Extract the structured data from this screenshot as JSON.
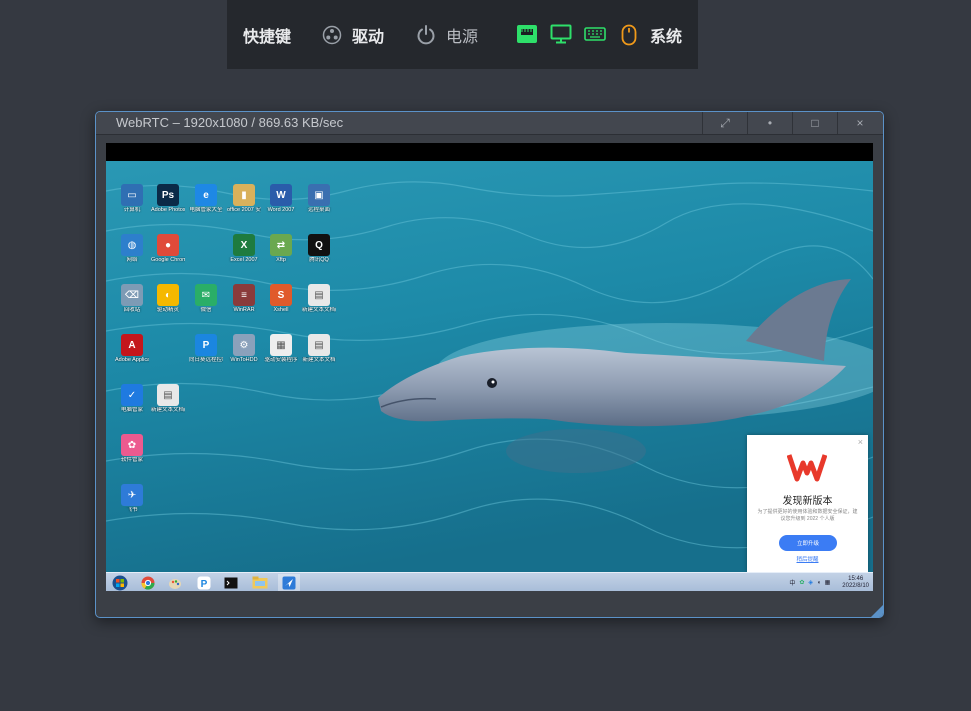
{
  "toolbar": {
    "shortcuts_label": "快捷键",
    "driver_label": "驱动",
    "power_label": "电源",
    "system_label": "系统",
    "colors": {
      "green": "#2ee06a",
      "orange": "#f19a1a",
      "gray": "#9aa0a8"
    }
  },
  "window": {
    "title": "WebRTC – 1920x1080 / 869.63 KB/sec",
    "buttons": {
      "expand": "⤢",
      "dot": "•",
      "maximize": "□",
      "close": "×"
    }
  },
  "desktop": {
    "icons": [
      {
        "label": "计算机",
        "glyph": "▭",
        "color": "#2f6fb3"
      },
      {
        "label": "Adobe Photosh...",
        "glyph": "Ps",
        "color": "#0b2a47"
      },
      {
        "label": "电脑管家大全",
        "glyph": "e",
        "color": "#1e88e5"
      },
      {
        "label": "office 2007 安装中文版",
        "glyph": "▮",
        "color": "#d9b15b"
      },
      {
        "label": "Word 2007",
        "glyph": "W",
        "color": "#2a5caa"
      },
      {
        "label": "远程桌面",
        "glyph": "▣",
        "color": "#3a6fb0"
      },
      {
        "label": "网络",
        "glyph": "◍",
        "color": "#2d7fcc"
      },
      {
        "label": "Google Chrome",
        "glyph": "●",
        "color": "#e04a3a"
      },
      {
        "label": "Excel 2007",
        "glyph": "X",
        "color": "#1e7b3f"
      },
      {
        "label": "Xftp",
        "glyph": "⇄",
        "color": "#6aa84f"
      },
      {
        "label": "腾讯QQ",
        "glyph": "Q",
        "color": "#111111"
      },
      {
        "label": "回收站",
        "glyph": "⌫",
        "color": "#7d9bb5"
      },
      {
        "label": "驱动精灵",
        "glyph": "◐",
        "color": "#f5b800"
      },
      {
        "label": "微信",
        "glyph": "✉",
        "color": "#2aae67"
      },
      {
        "label": "WinRAR",
        "glyph": "≡",
        "color": "#8a3b3b"
      },
      {
        "label": "Xshell",
        "glyph": "S",
        "color": "#e05a2b"
      },
      {
        "label": "新建文本文档(3)",
        "glyph": "▤",
        "color": "#e8e8e8"
      },
      {
        "label": "Adobe Applicati...",
        "glyph": "A",
        "color": "#c4161c"
      },
      {
        "label": "向日葵远程控制",
        "glyph": "P",
        "color": "#1b86e0"
      },
      {
        "label": "WinToHDD",
        "glyph": "⚙",
        "color": "#8aa1bb"
      },
      {
        "label": "驱动安装程序",
        "glyph": "▦",
        "color": "#eeeeee"
      },
      {
        "label": "新建文本文档",
        "glyph": "▤",
        "color": "#e8e8e8"
      },
      {
        "label": "电脑管家",
        "glyph": "✓",
        "color": "#1f7ae0"
      },
      {
        "label": "新建文本文档(2)",
        "glyph": "▤",
        "color": "#e8e8e8"
      },
      {
        "label": "软件管家",
        "glyph": "✿",
        "color": "#ec5a8f"
      },
      {
        "label": "飞书",
        "glyph": "✈",
        "color": "#2e7bd8"
      }
    ]
  },
  "popup": {
    "title": "发现新版本",
    "desc": "为了提供更好的使用体验和数据安全保证，建议您升级到 2022 个人版",
    "button": "立即升级",
    "later": "稍后提醒",
    "close": "×"
  },
  "taskbar": {
    "time": "15:46",
    "date": "2022/8/10",
    "tray_text": "中"
  }
}
